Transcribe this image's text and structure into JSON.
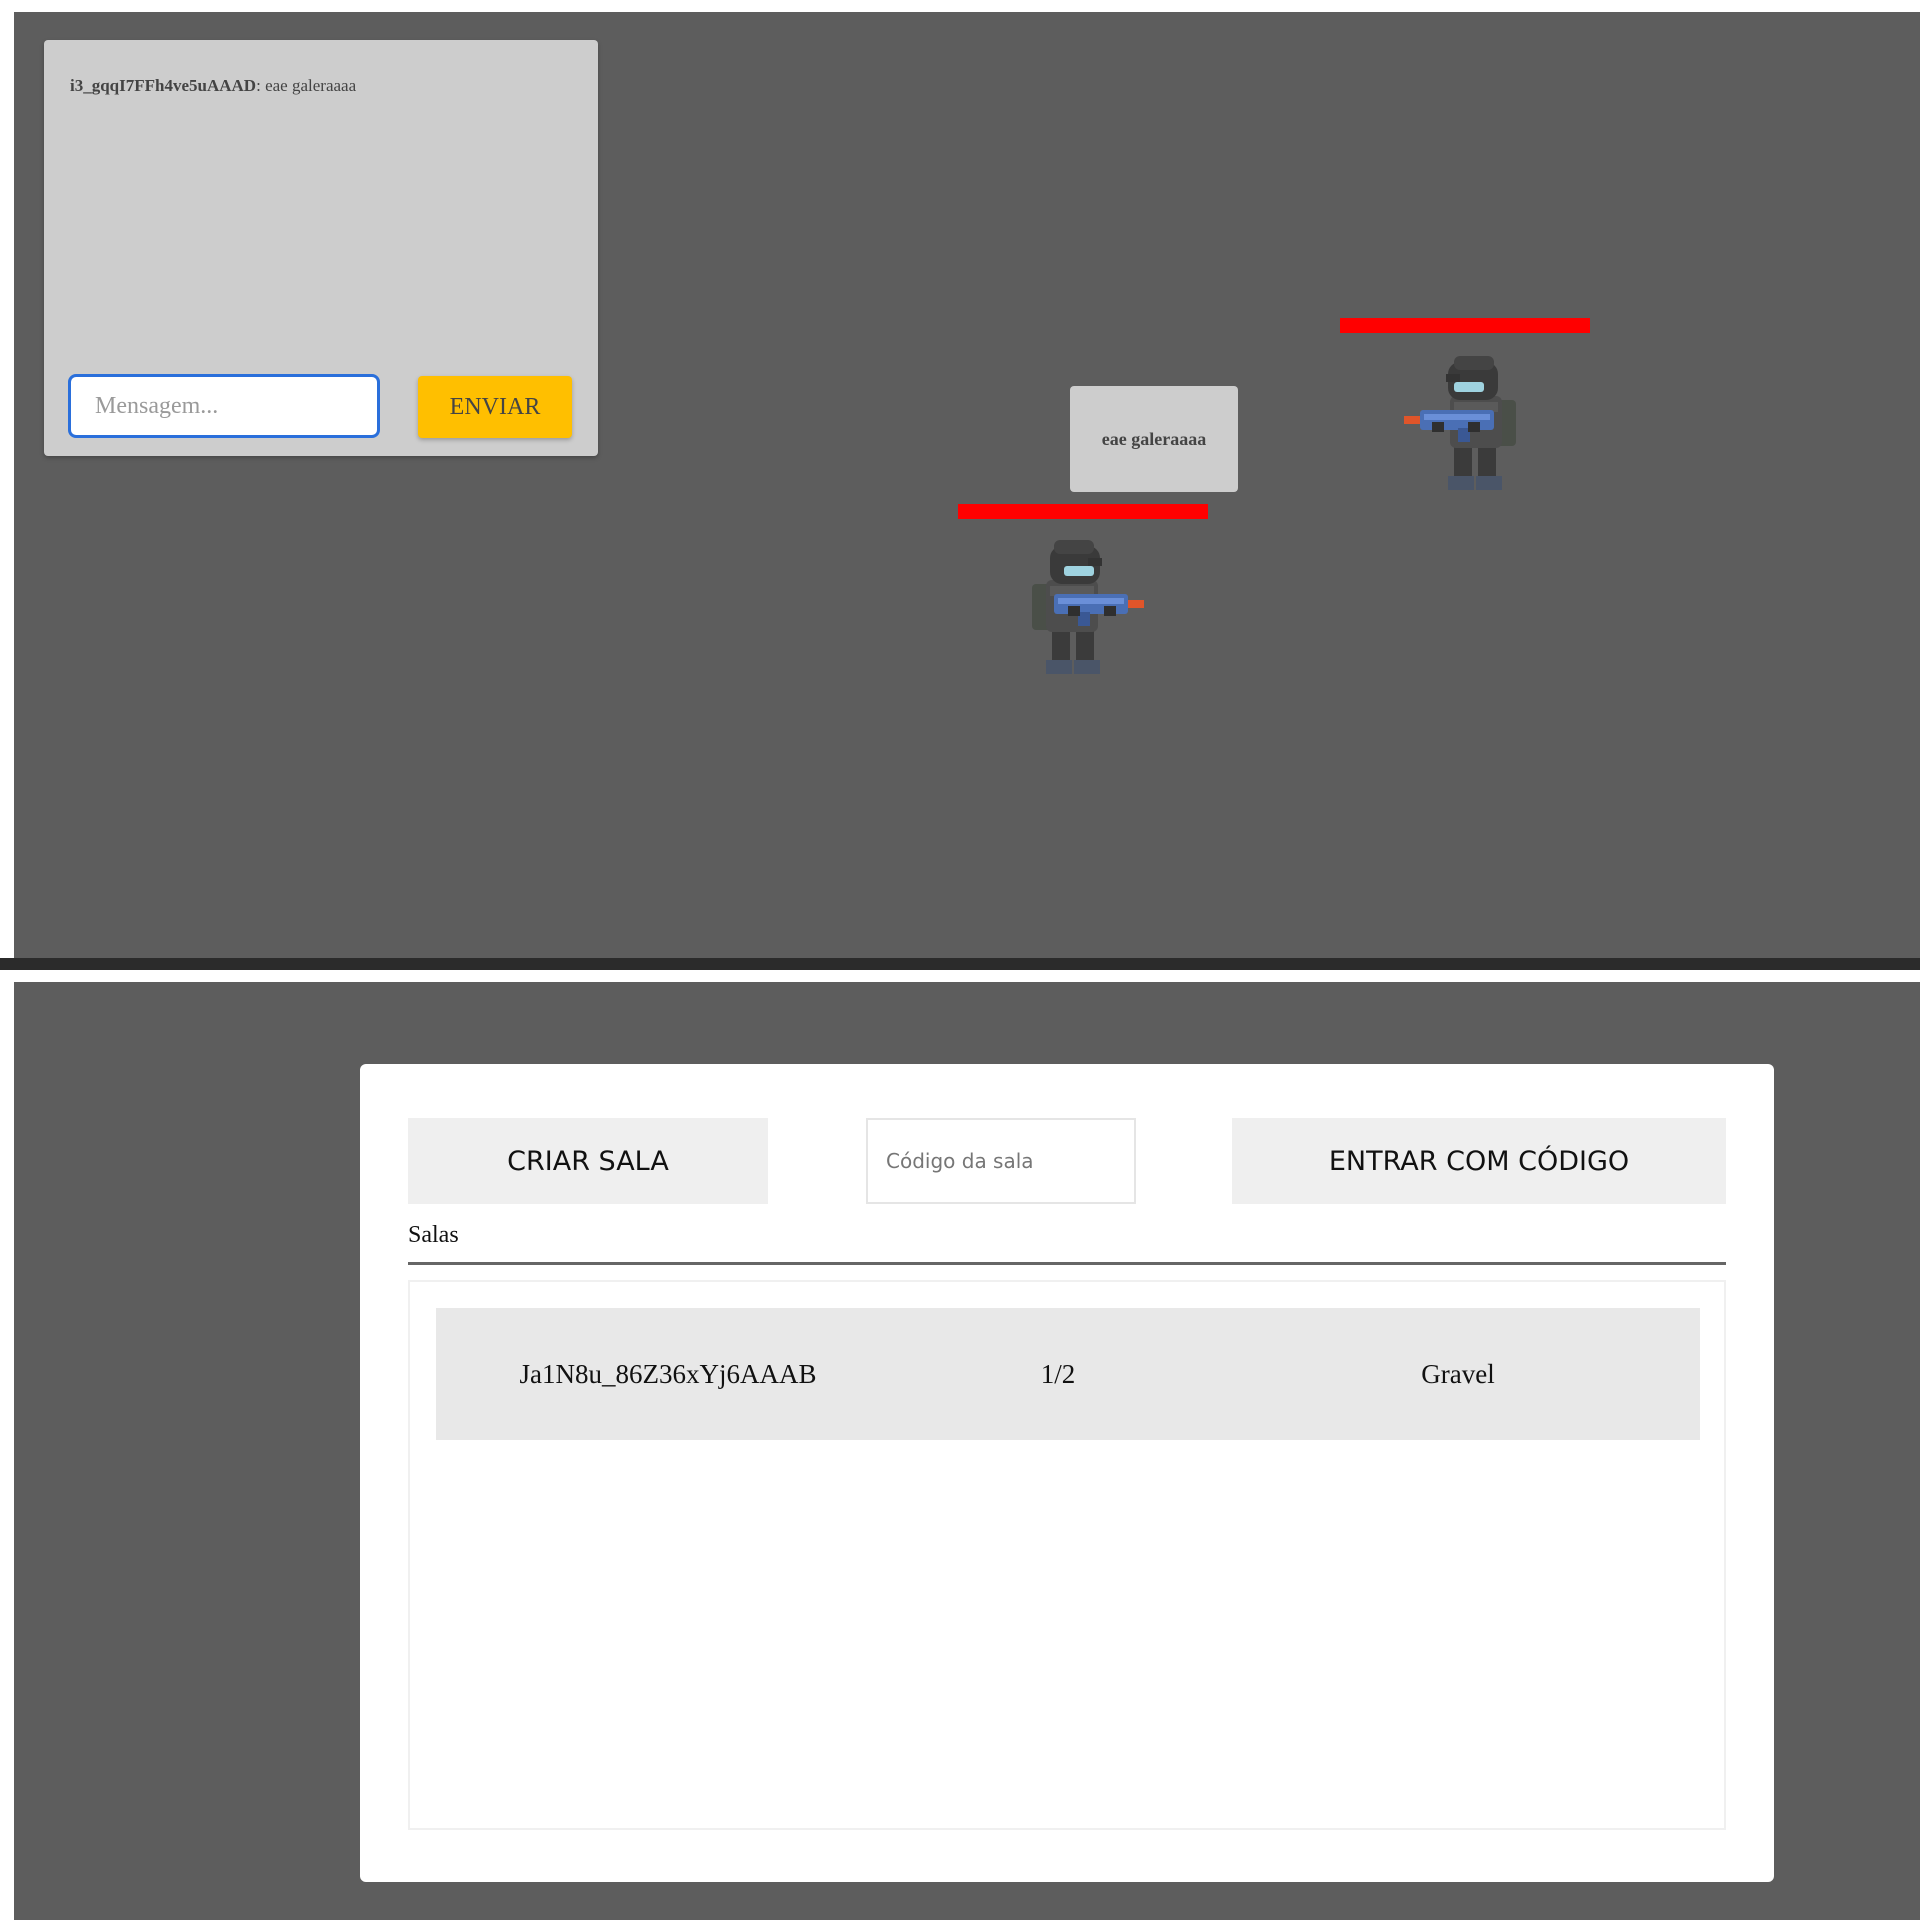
{
  "game": {
    "chat": {
      "messages": [
        {
          "sender": "i3_gqqI7FFh4ve5uAAAD",
          "text": "eae galeraaaa"
        }
      ],
      "input_placeholder": "Mensagem...",
      "send_label": "ENVIAR"
    },
    "speech_bubble": "eae galeraaaa"
  },
  "lobby": {
    "create_label": "CRIAR SALA",
    "code_placeholder": "Código da sala",
    "join_label": "ENTRAR COM CÓDIGO",
    "rooms_heading": "Salas",
    "rooms": [
      {
        "id": "Ja1N8u_86Z36xYj6AAAB",
        "players": "1/2",
        "map": "Gravel"
      }
    ]
  },
  "colors": {
    "background": "#5d5d5d",
    "send_button": "#ffbf00",
    "health_bar": "#ff0000",
    "input_focus": "#2a6fdb"
  },
  "icons": {
    "player_sprite": "soldier-with-rifle-icon"
  }
}
